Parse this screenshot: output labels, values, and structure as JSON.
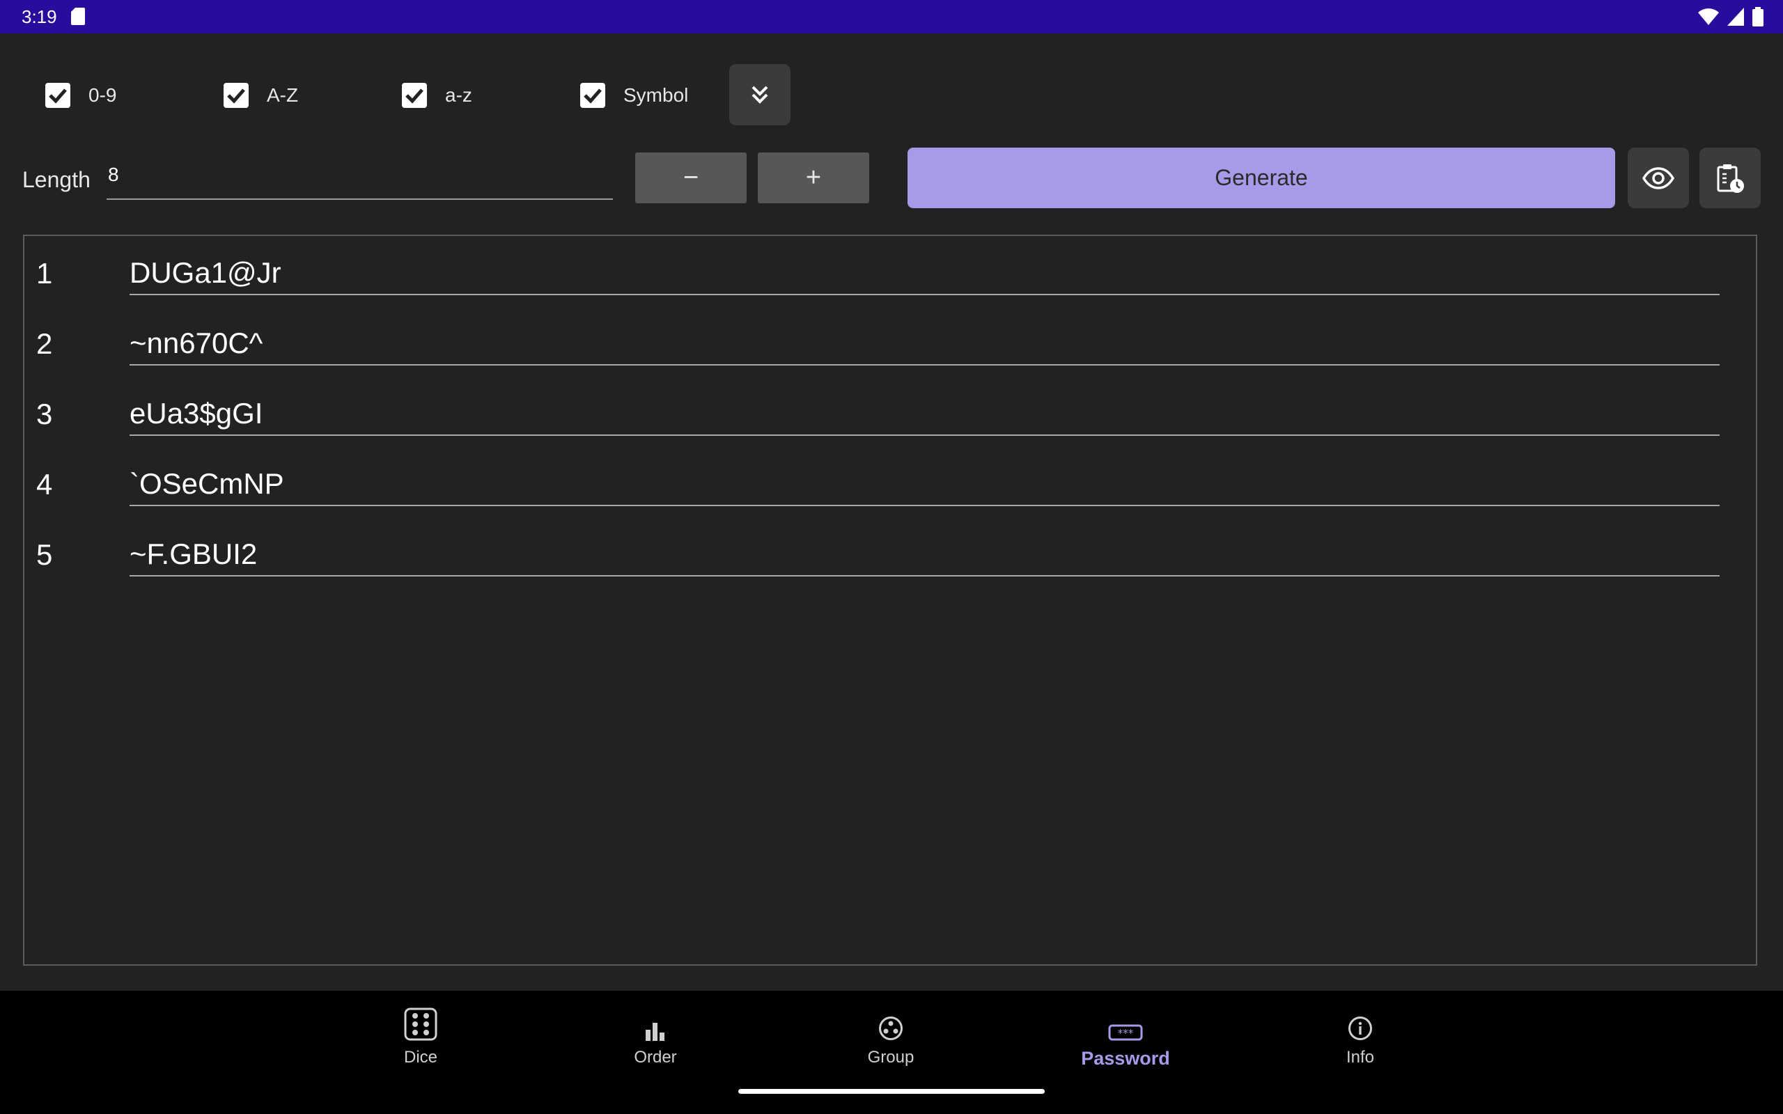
{
  "status_bar": {
    "time": "3:19"
  },
  "options": [
    {
      "label": "0-9",
      "checked": true
    },
    {
      "label": "A-Z",
      "checked": true
    },
    {
      "label": "a-z",
      "checked": true
    },
    {
      "label": "Symbol",
      "checked": true
    }
  ],
  "length": {
    "label": "Length",
    "value": "8"
  },
  "buttons": {
    "minus": "−",
    "plus": "+",
    "generate": "Generate"
  },
  "results": [
    {
      "index": "1",
      "password": "DUGa1@Jr"
    },
    {
      "index": "2",
      "password": "~nn670C^"
    },
    {
      "index": "3",
      "password": "eUa3$gGI"
    },
    {
      "index": "4",
      "password": "`OSeCmNP"
    },
    {
      "index": "5",
      "password": "~F.GBUI2"
    }
  ],
  "nav": {
    "items": [
      {
        "label": "Dice",
        "icon": "dice-icon"
      },
      {
        "label": "Order",
        "icon": "bar-chart-icon"
      },
      {
        "label": "Group",
        "icon": "group-icon"
      },
      {
        "label": "Password",
        "icon": "password-icon",
        "active": true
      },
      {
        "label": "Info",
        "icon": "info-icon"
      }
    ]
  },
  "colors": {
    "status_bar": "#2a0c9c",
    "background": "#222222",
    "accent": "#a89ae9",
    "nav_background": "#000000"
  }
}
